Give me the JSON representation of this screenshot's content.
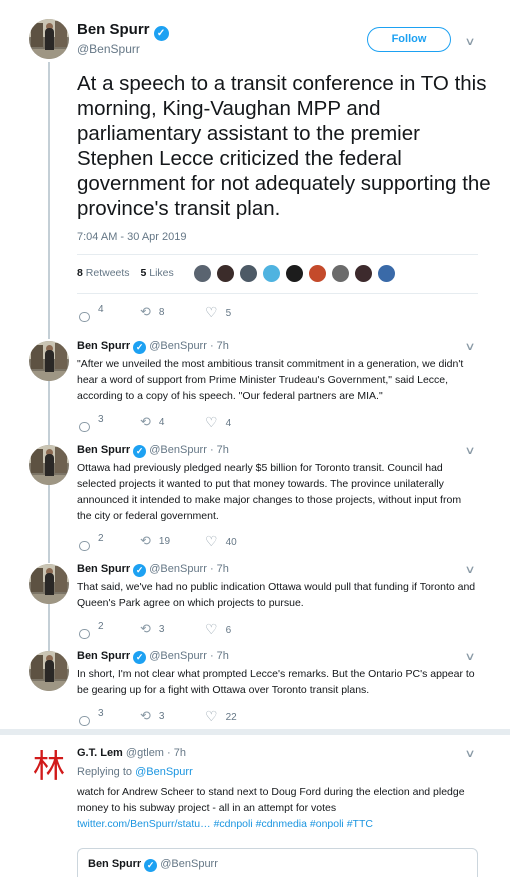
{
  "main": {
    "name": "Ben Spurr",
    "handle": "@BenSpurr",
    "follow_label": "Follow",
    "text": "At a speech to a transit conference in TO this morning, King-Vaughan MPP and parliamentary assistant to the premier Stephen Lecce criticized the federal government for not adequately supporting the province's transit plan.",
    "timestamp": "7:04 AM - 30 Apr 2019",
    "retweets_count": "8",
    "retweets_label": "Retweets",
    "likes_count": "5",
    "likes_label": "Likes",
    "actions": {
      "replies": "4",
      "retweets": "8",
      "likes": "5"
    }
  },
  "likers": [
    {
      "color": "#5a6470",
      "icon": "person-avatar"
    },
    {
      "color": "#3b2c2a",
      "icon": "person-avatar"
    },
    {
      "color": "#4d5a66",
      "icon": "person-avatar"
    },
    {
      "color": "#4fb3e0",
      "icon": "logo-avatar"
    },
    {
      "color": "#1c1c1c",
      "icon": "person-avatar"
    },
    {
      "color": "#c44a2b",
      "icon": "logo-avatar"
    },
    {
      "color": "#6b6b6b",
      "icon": "person-avatar"
    },
    {
      "color": "#3d2a2d",
      "icon": "person-avatar"
    },
    {
      "color": "#3a6aa8",
      "icon": "logo-avatar"
    }
  ],
  "replies": [
    {
      "name": "Ben Spurr",
      "handle": "@BenSpurr",
      "time": "· 7h",
      "text": "\"After we unveiled the most ambitious transit commitment in a generation, we didn't hear a word of support from Prime Minister Trudeau's Government,\" said Lecce, according to a copy of his speech. \"Our federal partners are MIA.\"",
      "replies": "3",
      "retweets": "4",
      "likes": "4"
    },
    {
      "name": "Ben Spurr",
      "handle": "@BenSpurr",
      "time": "· 7h",
      "text": "Ottawa had previously pledged nearly $5 billion for Toronto transit. Council had selected projects it wanted to put that money towards. The province unilaterally announced it intended to make major changes to those projects, without input from the city or federal government.",
      "replies": "2",
      "retweets": "19",
      "likes": "40"
    },
    {
      "name": "Ben Spurr",
      "handle": "@BenSpurr",
      "time": "· 7h",
      "text": "That said, we've had no public indication Ottawa would pull that funding if Toronto and Queen's Park agree on which projects to pursue.",
      "replies": "2",
      "retweets": "3",
      "likes": "6"
    },
    {
      "name": "Ben Spurr",
      "handle": "@BenSpurr",
      "time": "· 7h",
      "text": "In short, I'm not clear what prompted Lecce's remarks. But the Ontario PC's appear to be gearing up for a fight with Ottawa over Toronto transit plans.",
      "replies": "3",
      "retweets": "3",
      "likes": "22"
    }
  ],
  "gt": {
    "avatar_glyph": "林",
    "name": "G.T. Lem",
    "handle": "@gtlem",
    "time": "· 7h",
    "replying_label": "Replying to",
    "replying_to": "@BenSpurr",
    "text": "watch for Andrew Scheer to stand next to Doug Ford during the election  and pledge money to his subway project - all in an attempt for votes",
    "links": [
      "twitter.com/BenSpurr/statu…",
      "#cdnpoli",
      "#cdnmedia",
      "#onpoli",
      "#TTC"
    ]
  },
  "quote": {
    "name": "Ben Spurr",
    "handle": "@BenSpurr"
  },
  "colors": {
    "accent": "#1da1f2",
    "link": "#1b95e0",
    "muted": "#657786"
  }
}
